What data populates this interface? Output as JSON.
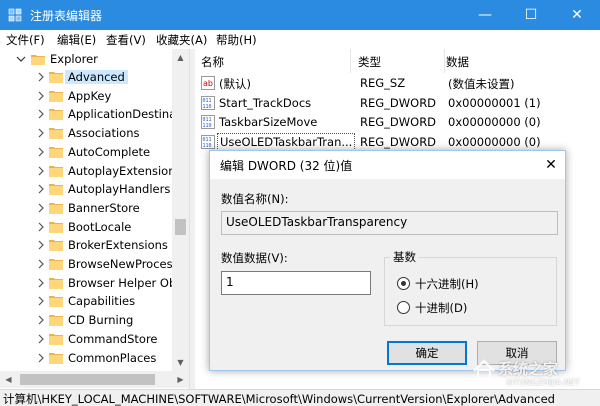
{
  "window": {
    "title": "注册表编辑器",
    "app_icon": "regedit-icon",
    "controls": {
      "minimize": "—",
      "maximize": "☐",
      "close": "✕"
    },
    "accent": "#2b8be0"
  },
  "menu": [
    {
      "label": "文件(F)"
    },
    {
      "label": "编辑(E)"
    },
    {
      "label": "查看(V)"
    },
    {
      "label": "收藏夹(A)"
    },
    {
      "label": "帮助(H)"
    }
  ],
  "tree": {
    "root": {
      "label": "Explorer",
      "expanded": true
    },
    "items": [
      {
        "label": "Advanced",
        "selected": true
      },
      {
        "label": "AppKey"
      },
      {
        "label": "ApplicationDestinat"
      },
      {
        "label": "Associations"
      },
      {
        "label": "AutoComplete"
      },
      {
        "label": "AutoplayExtensions"
      },
      {
        "label": "AutoplayHandlers"
      },
      {
        "label": "BannerStore"
      },
      {
        "label": "BootLocale"
      },
      {
        "label": "BrokerExtensions"
      },
      {
        "label": "BrowseNewProcess"
      },
      {
        "label": "Browser Helper Ob"
      },
      {
        "label": "Capabilities"
      },
      {
        "label": "CD Burning"
      },
      {
        "label": "CommandStore"
      },
      {
        "label": "CommonPlaces"
      }
    ]
  },
  "list": {
    "columns": {
      "name": "名称",
      "type": "类型",
      "data": "数据"
    },
    "rows": [
      {
        "icon": "string-value-icon",
        "name": "(默认)",
        "type": "REG_SZ",
        "data": "(数值未设置)"
      },
      {
        "icon": "binary-value-icon",
        "name": "Start_TrackDocs",
        "type": "REG_DWORD",
        "data": "0x00000001 (1)"
      },
      {
        "icon": "binary-value-icon",
        "name": "TaskbarSizeMove",
        "type": "REG_DWORD",
        "data": "0x00000000 (0)"
      },
      {
        "icon": "binary-value-icon",
        "name": "UseOLEDTaskbarTran...",
        "type": "REG_DWORD",
        "data": "0x00000000 (0)",
        "selected": true
      }
    ]
  },
  "statusbar": {
    "path": "计算机\\HKEY_LOCAL_MACHINE\\SOFTWARE\\Microsoft\\Windows\\CurrentVersion\\Explorer\\Advanced"
  },
  "dialog": {
    "title": "编辑 DWORD (32 位)值",
    "close": "✕",
    "name_label": "数值名称(N):",
    "name_value": "UseOLEDTaskbarTransparency",
    "data_label": "数值数据(V):",
    "data_value": "1",
    "base_label": "基数",
    "radios": [
      {
        "label": "十六进制(H)",
        "checked": true
      },
      {
        "label": "十进制(D)",
        "checked": false
      }
    ],
    "ok": "确定",
    "cancel": "取消",
    "accent": "#0078d7"
  },
  "watermark": {
    "text": "系统之家",
    "sub": "XITONGZHIJIA.NET"
  }
}
